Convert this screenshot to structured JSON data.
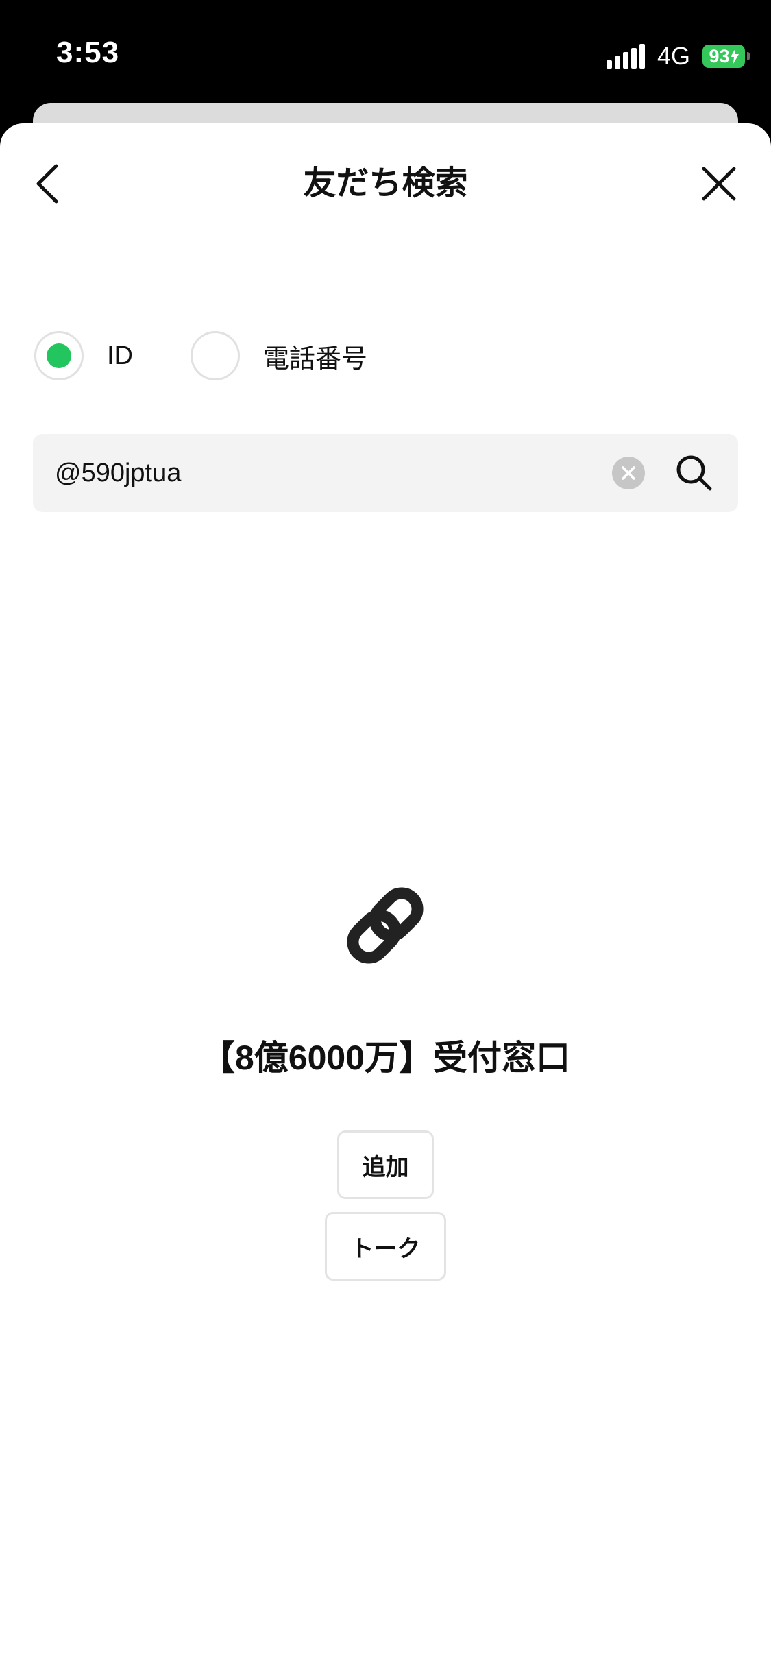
{
  "status_bar": {
    "time": "3:53",
    "network": "4G",
    "battery": "93"
  },
  "header": {
    "title": "友だち検索",
    "back_icon": "chevron-left-icon",
    "close_icon": "close-icon"
  },
  "search_type": {
    "options": [
      {
        "label": "ID",
        "selected": true
      },
      {
        "label": "電話番号",
        "selected": false
      }
    ],
    "selected_color": "#22c55e"
  },
  "search": {
    "value": "@590jptua",
    "clear_icon": "clear-icon",
    "search_icon": "search-icon"
  },
  "result": {
    "icon": "link-icon",
    "name": "【8億6000万】受付窓口",
    "add_label": "追加",
    "talk_label": "トーク"
  }
}
